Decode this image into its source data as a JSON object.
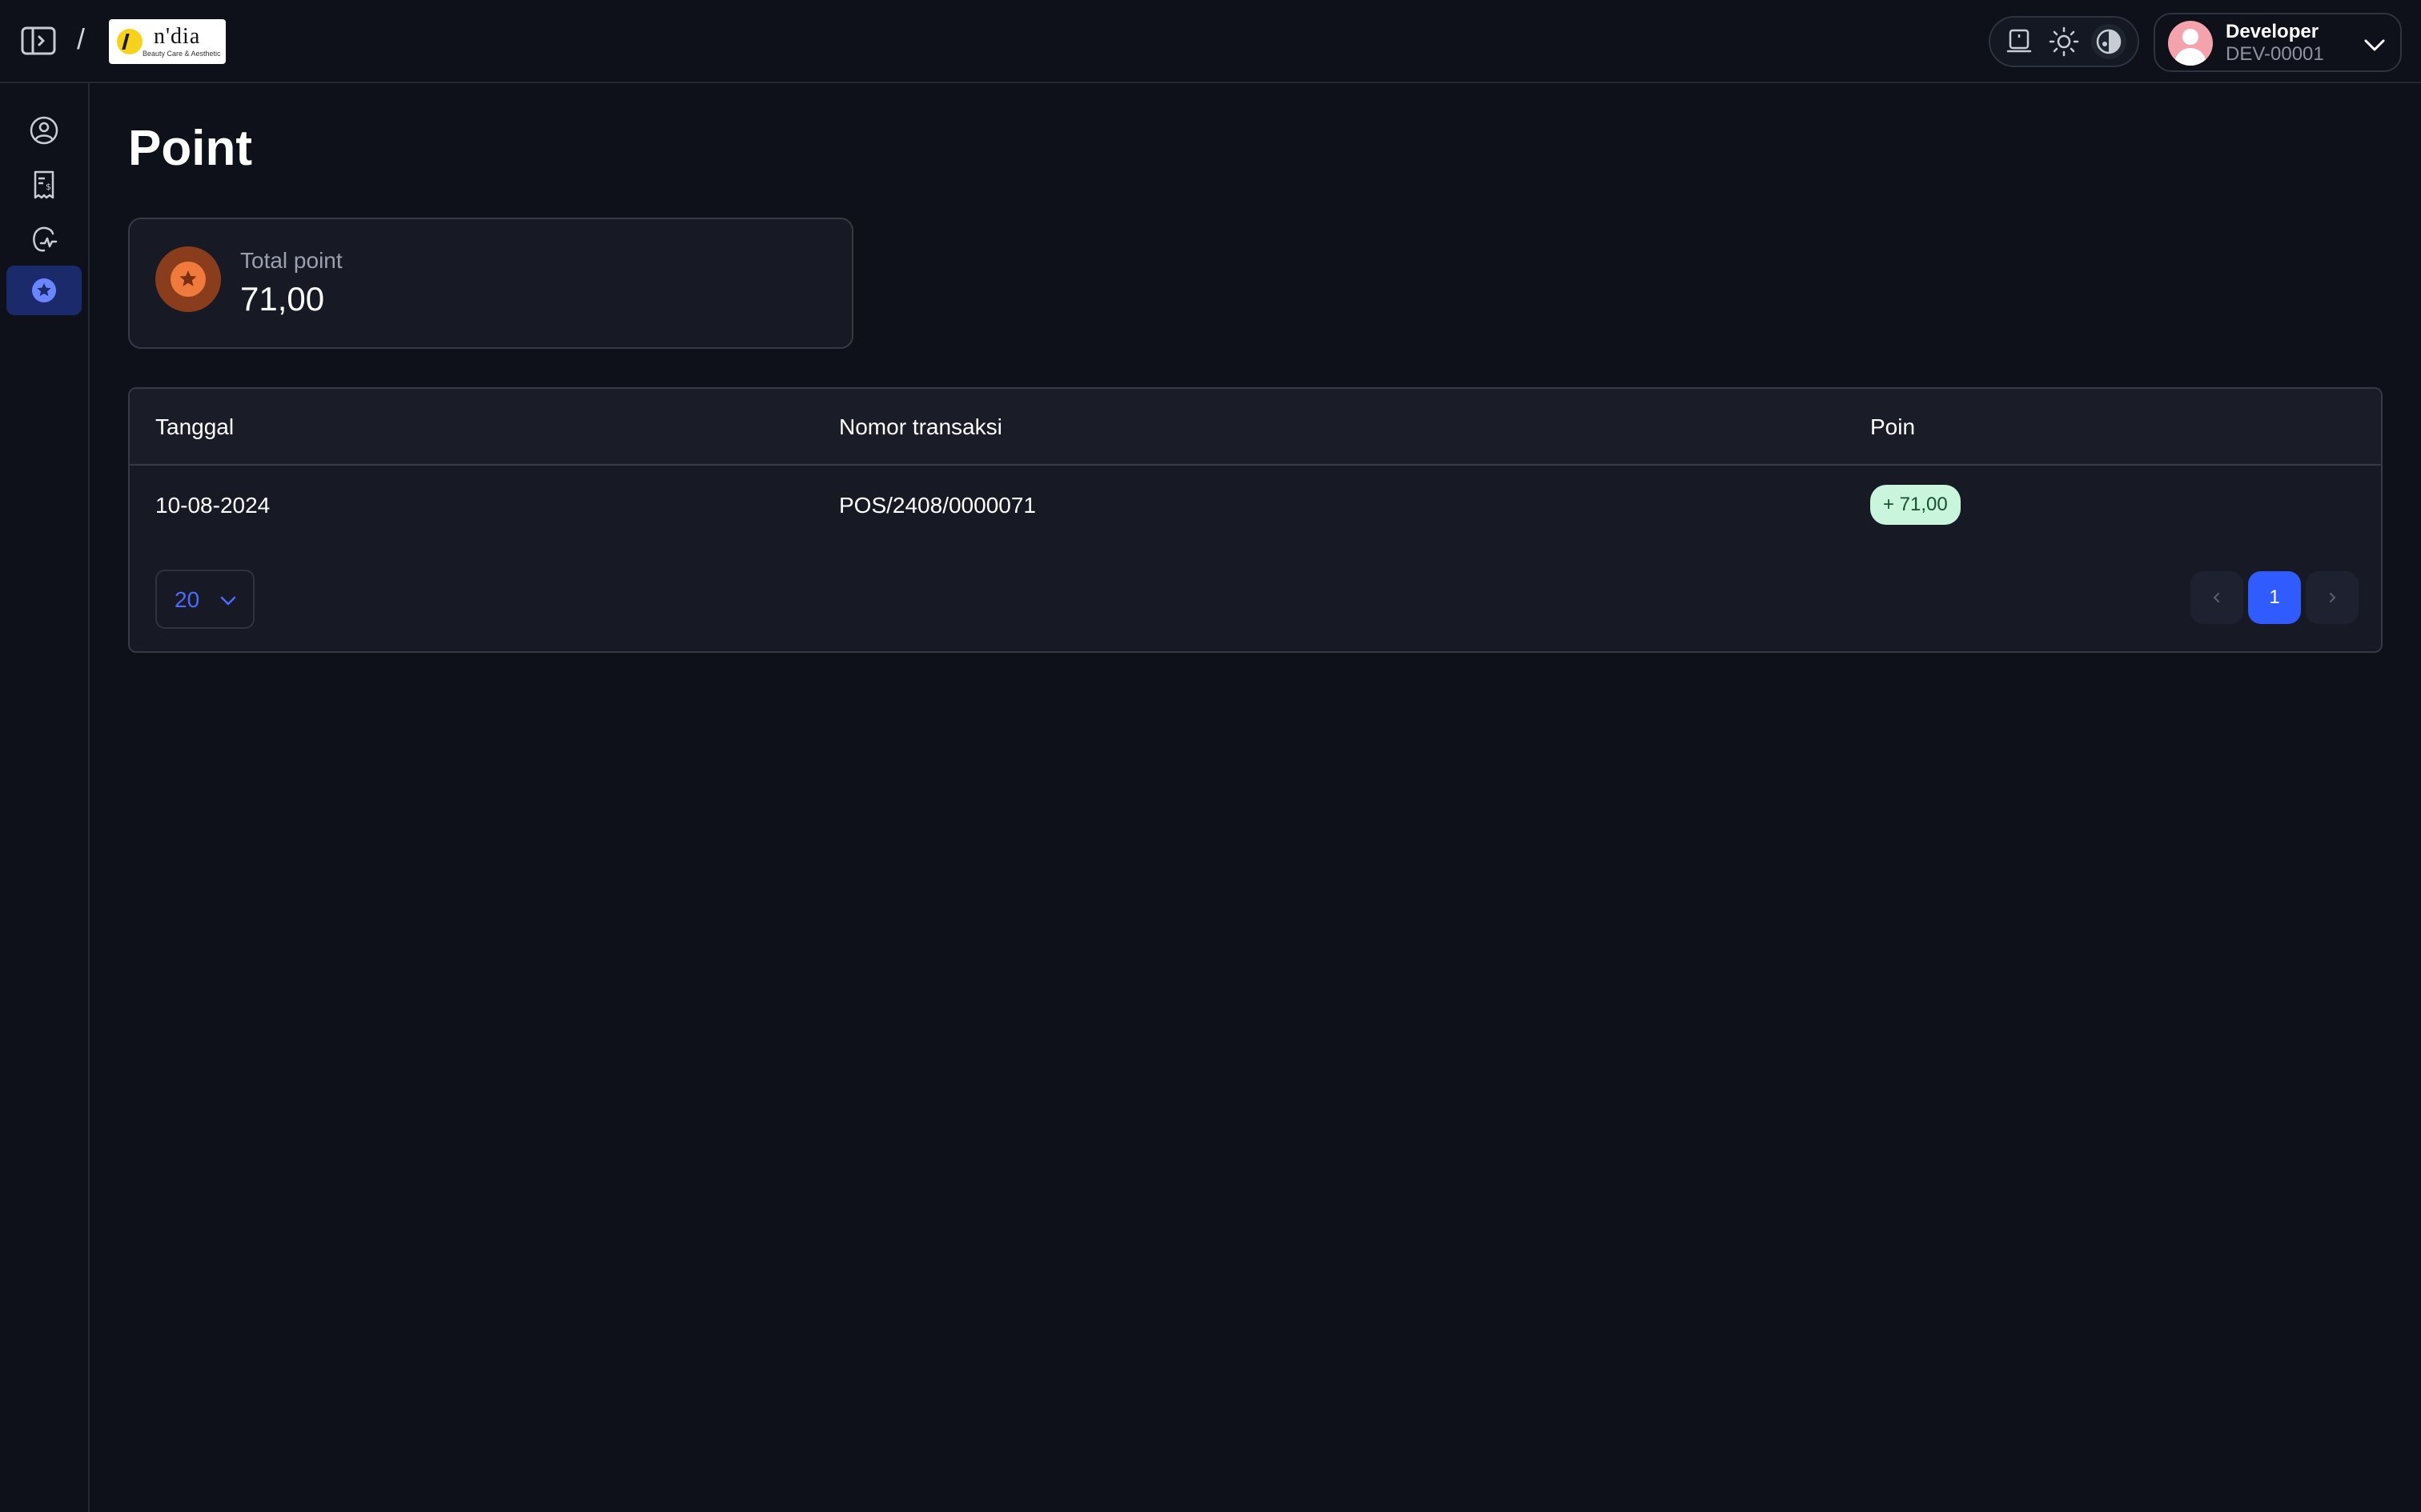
{
  "header": {
    "separator": "/",
    "logo": {
      "brand": "n'dia",
      "tagline": "Beauty Care & Aesthetic"
    },
    "theme_buttons": [
      "system-icon",
      "sun-icon",
      "contrast-icon"
    ],
    "user": {
      "name": "Developer",
      "id": "DEV-00001"
    }
  },
  "sidebar": {
    "items": [
      {
        "icon": "user-circle-icon",
        "active": false
      },
      {
        "icon": "receipt-icon",
        "active": false
      },
      {
        "icon": "health-icon",
        "active": false
      },
      {
        "icon": "star-badge-icon",
        "active": true
      }
    ]
  },
  "main": {
    "title": "Point",
    "summary": {
      "label": "Total point",
      "value": "71,00"
    },
    "table": {
      "columns": [
        "Tanggal",
        "Nomor transaksi",
        "Poin"
      ],
      "rows": [
        {
          "date": "10-08-2024",
          "transaction": "POS/2408/0000071",
          "points": "+ 71,00"
        }
      ]
    },
    "pagination": {
      "page_size": "20",
      "current_page": "1"
    }
  },
  "colors": {
    "background": "#0e111a",
    "accent": "#2f5bff",
    "badge_bg": "#c9f5dc",
    "point_icon": "#f07a3c"
  }
}
